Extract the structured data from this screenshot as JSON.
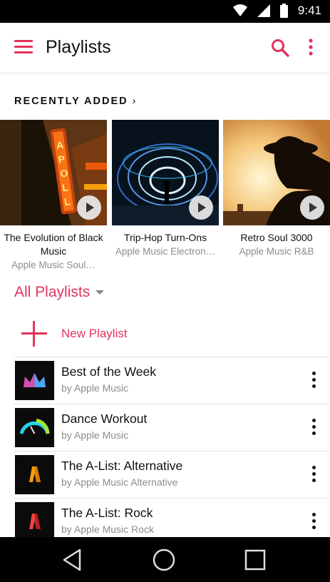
{
  "status_bar": {
    "time": "9:41",
    "icons": [
      "wifi-icon",
      "cell-signal-icon",
      "battery-icon"
    ]
  },
  "app_bar": {
    "title": "Playlists",
    "icons": [
      "menu-icon",
      "search-icon",
      "more-vert-icon"
    ]
  },
  "recently_added": {
    "header": "RECENTLY ADDED",
    "chevron": "›",
    "items": [
      {
        "title": "The Evolution of Black Music",
        "subtitle": "Apple Music Soul…",
        "art": "apollo-neon-sign"
      },
      {
        "title": "Trip-Hop Turn-Ons",
        "subtitle": "Apple Music Electron…",
        "art": "steel-wool-light"
      },
      {
        "title": "Retro Soul 3000",
        "subtitle": "Apple Music R&B",
        "art": "silhouette-sunset"
      }
    ]
  },
  "all_playlists": {
    "label": "All Playlists"
  },
  "new_playlist": {
    "label": "New Playlist"
  },
  "playlists": [
    {
      "title": "Best of the Week",
      "subtitle": "by Apple Music",
      "art": "crown-icon"
    },
    {
      "title": "Dance Workout",
      "subtitle": "by Apple Music",
      "art": "gauge-icon"
    },
    {
      "title": "The A-List: Alternative",
      "subtitle": "by Apple Music Alternative",
      "art": "orange-a-icon"
    },
    {
      "title": "The A-List: Rock",
      "subtitle": "by Apple Music Rock",
      "art": "red-a-icon"
    }
  ],
  "colors": {
    "accent": "#e2335a",
    "secondary_text": "#8c8c8c",
    "status_bar": "#000000"
  },
  "nav_bar": {
    "icons": [
      "back-icon",
      "home-icon",
      "recents-icon"
    ]
  }
}
